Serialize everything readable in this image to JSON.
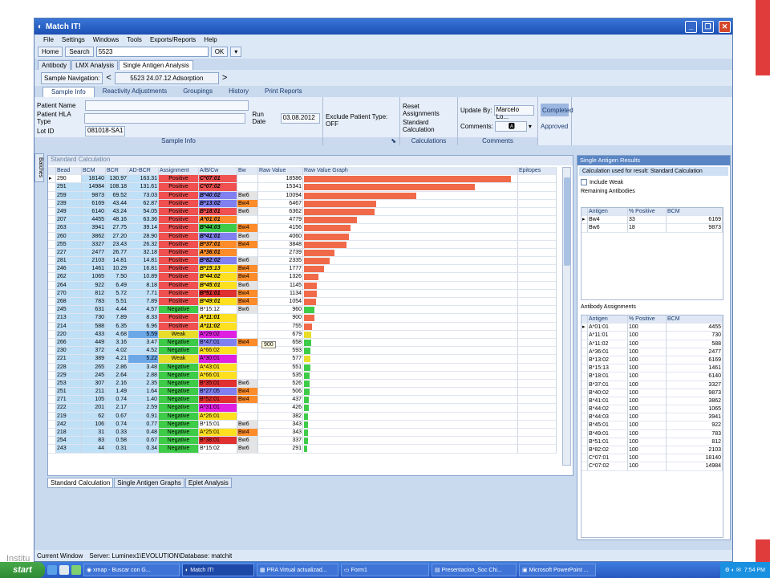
{
  "window": {
    "title": "Match IT!",
    "min": "_",
    "max": "❐",
    "close": "✕"
  },
  "menu": [
    "File",
    "Settings",
    "Windows",
    "Tools",
    "Exports/Reports",
    "Help"
  ],
  "toolbar": {
    "home": "Home",
    "search": "Search",
    "search_value": "5523",
    "ok": "OK"
  },
  "top_tabs": [
    "Antibody",
    "LMX Analysis",
    "Single Antigen Analysis"
  ],
  "nav": {
    "label": "Sample Navigation:",
    "prev": "<",
    "value": "5523 24.07.12 Adsorption",
    "next": ">"
  },
  "sample_tabs": [
    "Sample Info",
    "Reactivity Adjustments",
    "Groupings",
    "History",
    "Print Reports"
  ],
  "ribbon": {
    "patient_name": "Patient Name",
    "patient_hla": "Patient HLA Type",
    "lot_id": "Lot ID",
    "lot_value": "081018-SA1",
    "run_date": "Run Date",
    "run_date_value": "03.08.2012",
    "exclude": "Exclude Patient Type: OFF",
    "group_sample": "Sample Info",
    "reset": "Reset Assignments",
    "standard_calc": "Standard Calculation",
    "group_calc": "Calculations",
    "update_by": "Update By:",
    "update_by_value": "Marcelo Lo...",
    "comments": "Comments:",
    "group_comments": "Comments",
    "completed": "Completed",
    "approved": "Approved"
  },
  "side_tab": "Batches",
  "grid_panel_title": "Standard Calculation",
  "grid": {
    "headers": [
      "Bead",
      "BCM",
      "BCR",
      "AD-BCR",
      "Assignment",
      "A/B/Cw",
      "Bw",
      "Raw Value",
      "Raw Value Graph",
      "Epitopes"
    ],
    "rows": [
      [
        "290",
        "18140",
        "130.97",
        "163.31",
        "Positive",
        "C*07:01",
        "",
        "18586"
      ],
      [
        "291",
        "14984",
        "108.18",
        "131.61",
        "Positive",
        "C*07:02",
        "",
        "15341"
      ],
      [
        "259",
        "9873",
        "69.52",
        "73.03",
        "Positive",
        "B*40:02",
        "Bw6",
        "10094"
      ],
      [
        "239",
        "6169",
        "43.44",
        "62.87",
        "Positive",
        "B*13:02",
        "Bw4",
        "6467"
      ],
      [
        "249",
        "6140",
        "43.24",
        "54.05",
        "Positive",
        "B*18:01",
        "Bw6",
        "6362"
      ],
      [
        "207",
        "4455",
        "48.16",
        "63.36",
        "Positive",
        "A*01:01",
        "",
        "4779"
      ],
      [
        "263",
        "3941",
        "27.75",
        "39.14",
        "Positive",
        "B*44:03",
        "Bw4",
        "4156"
      ],
      [
        "260",
        "3862",
        "27.20",
        "28.90",
        "Positive",
        "B*41:01",
        "Bw6",
        "4060"
      ],
      [
        "255",
        "3327",
        "23.43",
        "26.32",
        "Positive",
        "B*37:01",
        "Bw4",
        "3848"
      ],
      [
        "227",
        "2477",
        "26.77",
        "32.18",
        "Positive",
        "A*36:01",
        "",
        "2739"
      ],
      [
        "281",
        "2103",
        "14.81",
        "14.81",
        "Positive",
        "B*82:02",
        "Bw6",
        "2335"
      ],
      [
        "246",
        "1461",
        "10.29",
        "16.81",
        "Positive",
        "B*15:13",
        "Bw4",
        "1777"
      ],
      [
        "262",
        "1065",
        "7.50",
        "10.89",
        "Positive",
        "B*44:02",
        "Bw4",
        "1326"
      ],
      [
        "264",
        "922",
        "6.49",
        "8.18",
        "Positive",
        "B*45:01",
        "Bw6",
        "1145"
      ],
      [
        "270",
        "812",
        "5.72",
        "7.71",
        "Positive",
        "B*51:01",
        "Bw4",
        "1134"
      ],
      [
        "268",
        "783",
        "5.51",
        "7.89",
        "Positive",
        "B*49:01",
        "Bw4",
        "1054"
      ],
      [
        "245",
        "631",
        "4.44",
        "4.57",
        "Negative",
        "B*15:12",
        "Bw6",
        "960"
      ],
      [
        "213",
        "730",
        "7.89",
        "8.33",
        "Positive",
        "A*11:01",
        "",
        "900"
      ],
      [
        "214",
        "588",
        "6.35",
        "6.96",
        "Positive",
        "A*11:02",
        "",
        "755"
      ],
      [
        "220",
        "433",
        "4.68",
        "5.59",
        "Weak",
        "A*29:02",
        "",
        "679"
      ],
      [
        "266",
        "449",
        "3.16",
        "3.47",
        "Negative",
        "B*47:01",
        "Bw4",
        "658"
      ],
      [
        "230",
        "372",
        "4.02",
        "4.52",
        "Negative",
        "A*66:02",
        "",
        "593"
      ],
      [
        "221",
        "389",
        "4.21",
        "5.22",
        "Weak",
        "A*30:01",
        "",
        "577"
      ],
      [
        "228",
        "265",
        "2.86",
        "3.48",
        "Negative",
        "A*43:01",
        "",
        "551"
      ],
      [
        "229",
        "245",
        "2.64",
        "2.88",
        "Negative",
        "A*66:01",
        "",
        "535"
      ],
      [
        "253",
        "307",
        "2.16",
        "2.35",
        "Negative",
        "B*35:01",
        "Bw6",
        "526"
      ],
      [
        "251",
        "211",
        "1.49",
        "1.64",
        "Negative",
        "B*27:05",
        "Bw4",
        "506"
      ],
      [
        "271",
        "105",
        "0.74",
        "1.40",
        "Negative",
        "B*52:01",
        "Bw4",
        "437"
      ],
      [
        "222",
        "201",
        "2.17",
        "2.59",
        "Negative",
        "A*31:01",
        "",
        "426"
      ],
      [
        "219",
        "62",
        "0.67",
        "0.91",
        "Negative",
        "A*26:01",
        "",
        "382"
      ],
      [
        "242",
        "106",
        "0.74",
        "0.77",
        "Negative",
        "B*15:01",
        "Bw6",
        "343"
      ],
      [
        "218",
        "31",
        "0.33",
        "0.48",
        "Negative",
        "A*25:01",
        "Bw4",
        "343"
      ],
      [
        "254",
        "83",
        "0.58",
        "0.67",
        "Negative",
        "B*38:01",
        "Bw6",
        "337"
      ],
      [
        "243",
        "44",
        "0.31",
        "0.34",
        "Negative",
        "B*15:02",
        "Bw6",
        "291"
      ]
    ]
  },
  "tooltip": "900",
  "bottom_tabs": [
    "Standard Calculation",
    "Single Antigen Graphs",
    "Eplet Analysis"
  ],
  "right": {
    "title": "Single Antigen Results",
    "calc_used": "Calculation used for result: Standard Calculation",
    "include_weak": "Include Weak",
    "remaining_title": "Remaining Antibodies",
    "remaining_headers": [
      "Antigen",
      "% Positive",
      "BCM"
    ],
    "remaining_rows": [
      [
        "Bw4",
        "33",
        "6169"
      ],
      [
        "Bw6",
        "18",
        "9873"
      ]
    ],
    "assign_title": "Antibody Assignments",
    "assign_headers": [
      "Antigen",
      "% Positive",
      "BCM"
    ],
    "assign_rows": [
      [
        "A*01:01",
        "100",
        "4455"
      ],
      [
        "A*11:01",
        "100",
        "730"
      ],
      [
        "A*11:02",
        "100",
        "588"
      ],
      [
        "A*36:01",
        "100",
        "2477"
      ],
      [
        "B*13:02",
        "100",
        "6169"
      ],
      [
        "B*15:13",
        "100",
        "1461"
      ],
      [
        "B*18:01",
        "100",
        "6140"
      ],
      [
        "B*37:01",
        "100",
        "3327"
      ],
      [
        "B*40:02",
        "100",
        "9873"
      ],
      [
        "B*41:01",
        "100",
        "3862"
      ],
      [
        "B*44:02",
        "100",
        "1065"
      ],
      [
        "B*44:03",
        "100",
        "3941"
      ],
      [
        "B*45:01",
        "100",
        "922"
      ],
      [
        "B*49:01",
        "100",
        "783"
      ],
      [
        "B*51:01",
        "100",
        "812"
      ],
      [
        "B*82:02",
        "100",
        "2103"
      ],
      [
        "C*07:01",
        "100",
        "18140"
      ],
      [
        "C*07:02",
        "100",
        "14984"
      ]
    ]
  },
  "status": {
    "current_window": "Current Window",
    "server": "Server: Luminex1\\EVOLUTION\\Database: matchit"
  },
  "background_text": "Institu",
  "taskbar": {
    "start": "start",
    "items": [
      "xmap - Buscar con G...",
      "Match IT!",
      "PRA Virtual actualizad...",
      "Form1",
      "Presentacion_Soc Chi...",
      "Microsoft PowerPoint ..."
    ],
    "time": "7:54 PM"
  }
}
